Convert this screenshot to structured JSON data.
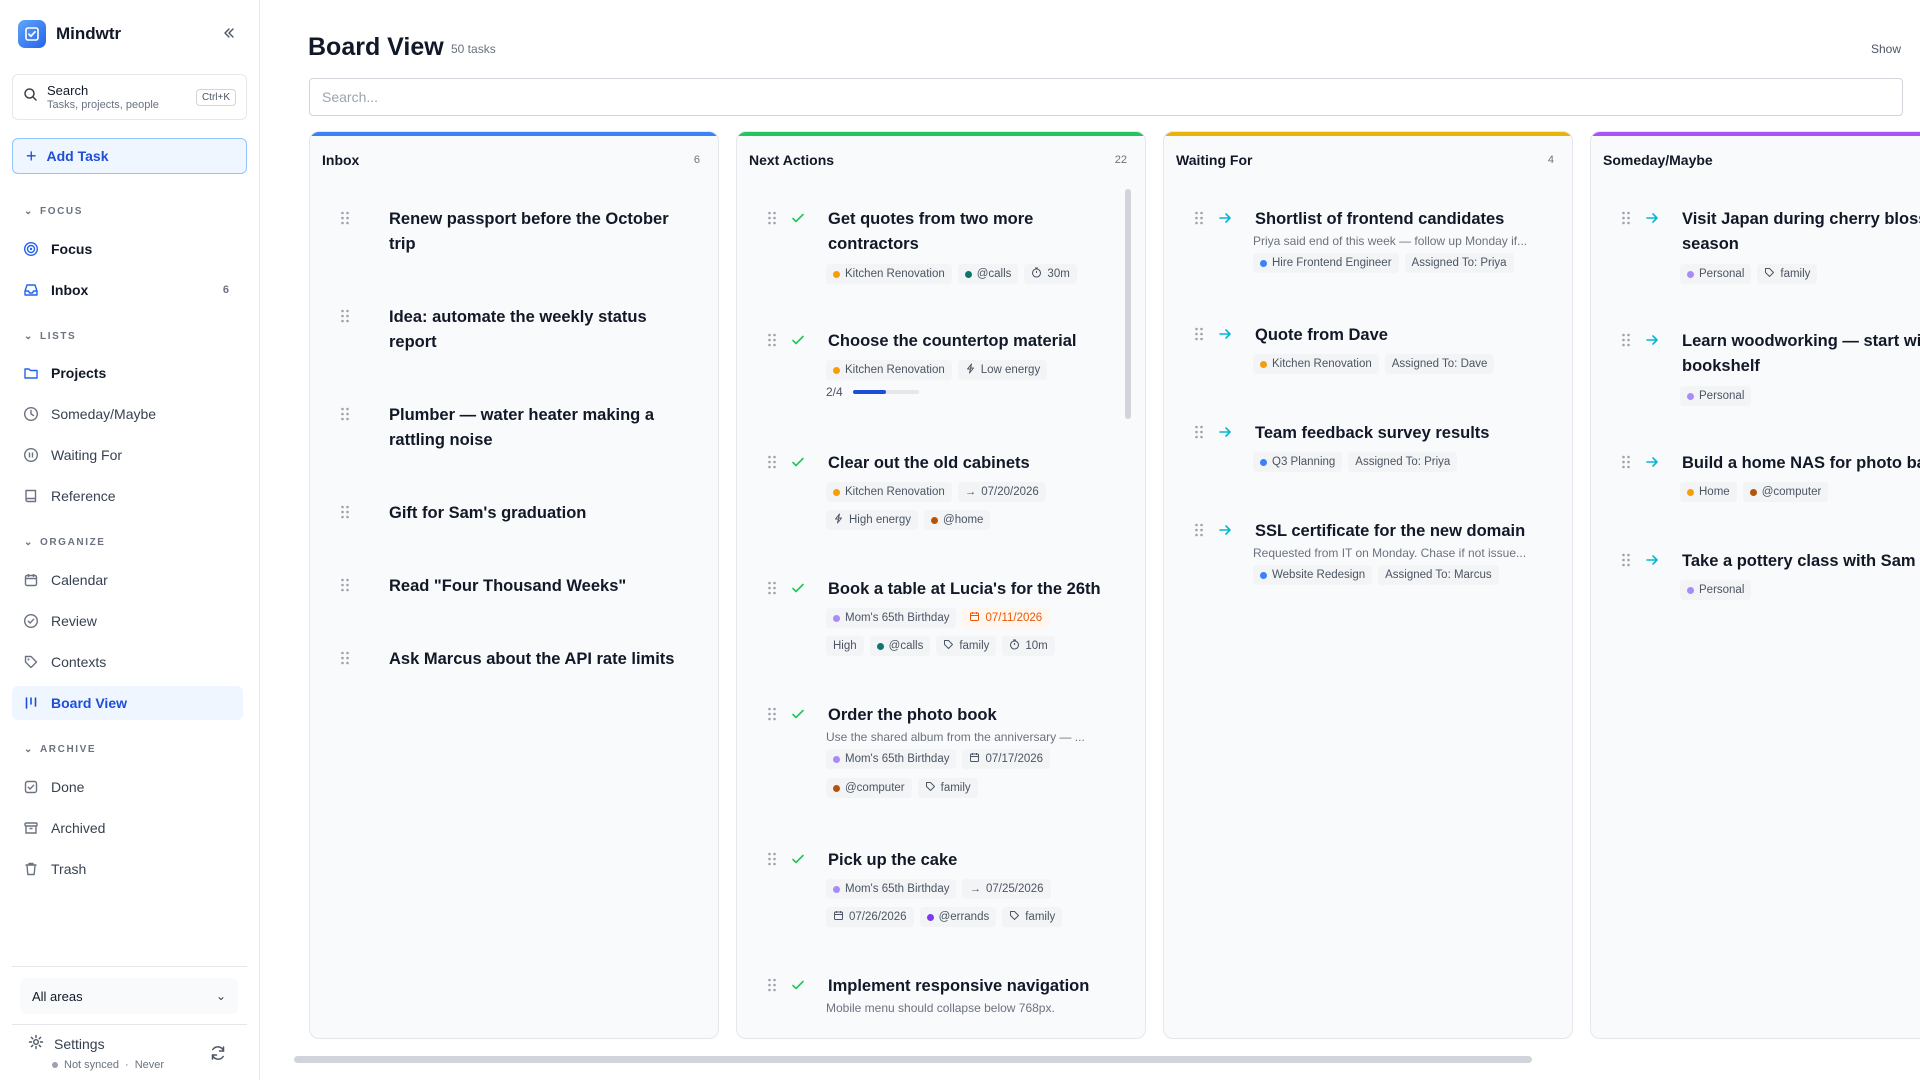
{
  "app": {
    "name": "Mindwtr"
  },
  "sidebar": {
    "search": {
      "title": "Search",
      "subtitle": "Tasks, projects, people",
      "shortcut": "Ctrl+K"
    },
    "add_task": "Add Task",
    "sections": {
      "focus": "FOCUS",
      "lists": "LISTS",
      "organize": "ORGANIZE",
      "archive": "ARCHIVE"
    },
    "items": {
      "focus": "Focus",
      "inbox": "Inbox",
      "inbox_count": "6",
      "projects": "Projects",
      "someday": "Someday/Maybe",
      "waiting": "Waiting For",
      "reference": "Reference",
      "calendar": "Calendar",
      "review": "Review",
      "contexts": "Contexts",
      "board": "Board View",
      "done": "Done",
      "archived": "Archived",
      "trash": "Trash"
    },
    "area_select": "All areas",
    "settings": "Settings",
    "sync_status": "Not synced",
    "sync_separator": "·",
    "sync_time": "Never"
  },
  "header": {
    "title": "Board View",
    "task_total": "50 tasks",
    "show_label": "Show",
    "search_placeholder": "Search..."
  },
  "colors": {
    "inbox": "#3b82f6",
    "next": "#22c55e",
    "waiting": "#eab308",
    "someday": "#a855f7",
    "kitchen": "#f59e0b",
    "calls": "#0f766e",
    "birthday": "#a78bfa",
    "home_ctx": "#b45309",
    "computer": "#b45309",
    "errands": "#7c3aed",
    "hire": "#3b82f6",
    "q3": "#3b82f6",
    "website": "#3b82f6",
    "personal": "#a78bfa",
    "home_area": "#f59e0b"
  },
  "columns": {
    "inbox": {
      "title": "Inbox",
      "count": "6",
      "cards": [
        {
          "title": "Renew passport before the October trip"
        },
        {
          "title": "Idea: automate the weekly status report"
        },
        {
          "title": "Plumber — water heater making a rattling noise"
        },
        {
          "title": "Gift for Sam's graduation"
        },
        {
          "title": "Read \"Four Thousand Weeks\""
        },
        {
          "title": "Ask Marcus about the API rate limits"
        }
      ]
    },
    "next": {
      "title": "Next Actions",
      "count": "22",
      "cards": [
        {
          "title": "Get quotes from two more contractors",
          "chips": [
            "Kitchen Renovation",
            "@calls",
            "30m"
          ]
        },
        {
          "title": "Choose the countertop material",
          "chips": [
            "Kitchen Renovation",
            "Low energy"
          ],
          "progress": "2/4",
          "progress_fraction": 0.5
        },
        {
          "title": "Clear out the old cabinets",
          "chips": [
            "Kitchen Renovation",
            "07/20/2026"
          ],
          "chips2": [
            "High energy",
            "@home"
          ]
        },
        {
          "title": "Book a table at Lucia's for the 26th",
          "chips": [
            "Mom's 65th Birthday",
            "07/11/2026"
          ],
          "chips2": [
            "High",
            "@calls",
            "family",
            "10m"
          ]
        },
        {
          "title": "Order the photo book",
          "desc": "Use the shared album from the anniversary — ...",
          "chips": [
            "Mom's 65th Birthday",
            "07/17/2026"
          ],
          "chips2": [
            "@computer",
            "family"
          ]
        },
        {
          "title": "Pick up the cake",
          "chips": [
            "Mom's 65th Birthday",
            "07/25/2026"
          ],
          "chips2": [
            "07/26/2026",
            "@errands",
            "family"
          ]
        },
        {
          "title": "Implement responsive navigation",
          "desc": "Mobile menu should collapse below 768px."
        }
      ]
    },
    "waiting": {
      "title": "Waiting For",
      "count": "4",
      "cards": [
        {
          "title": "Shortlist of frontend candidates",
          "desc": "Priya said end of this week — follow up Monday if...",
          "chips": [
            "Hire Frontend Engineer",
            "Assigned To: Priya"
          ]
        },
        {
          "title": "Quote from Dave",
          "chips": [
            "Kitchen Renovation",
            "Assigned To: Dave"
          ]
        },
        {
          "title": "Team feedback survey results",
          "chips": [
            "Q3 Planning",
            "Assigned To: Priya"
          ]
        },
        {
          "title": "SSL certificate for the new domain",
          "desc": "Requested from IT on Monday. Chase if not issue...",
          "chips": [
            "Website Redesign",
            "Assigned To: Marcus"
          ]
        }
      ]
    },
    "someday": {
      "title": "Someday/Maybe",
      "cards": [
        {
          "title": "Visit Japan during cherry blossom season",
          "chips": [
            "Personal",
            "family"
          ]
        },
        {
          "title": "Learn woodworking — start with a bookshelf",
          "chips": [
            "Personal"
          ]
        },
        {
          "title": "Build a home NAS for photo backups",
          "chips": [
            "Home",
            "@computer"
          ]
        },
        {
          "title": "Take a pottery class with Sam",
          "chips": [
            "Personal"
          ]
        }
      ]
    }
  }
}
